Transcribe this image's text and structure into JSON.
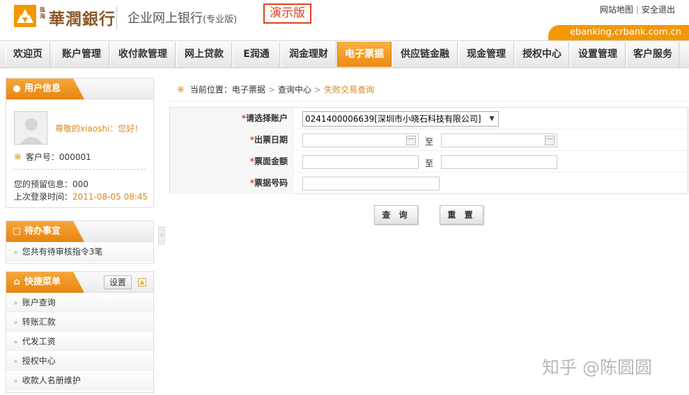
{
  "header": {
    "logo_small": "珠海",
    "bank_name": "華潤銀行",
    "system_name": "企业网上银行",
    "system_edition": "(专业版)",
    "demo_badge": "演示版",
    "links": [
      "网站地图",
      "安全退出"
    ],
    "domain": "ebanking.crbank.com.cn",
    "brand_color": "#f39800"
  },
  "nav": {
    "items": [
      {
        "label": "欢迎页"
      },
      {
        "label": "账户管理"
      },
      {
        "label": "收付款管理"
      },
      {
        "label": "网上贷款"
      },
      {
        "label": "E润通"
      },
      {
        "label": "润金理财"
      },
      {
        "label": "电子票据",
        "active": true
      },
      {
        "label": "供应链金融"
      },
      {
        "label": "现金管理"
      },
      {
        "label": "授权中心"
      },
      {
        "label": "设置管理"
      },
      {
        "label": "客户服务"
      }
    ]
  },
  "sidebar": {
    "user": {
      "title": "用户信息",
      "greeting": "尊敬的xiaoshi：您好!",
      "customer_label": "客户号：",
      "customer_no": "000001",
      "reserved_label": "您的预留信息：",
      "reserved_value": "000",
      "last_login_label": "上次登录时间：",
      "last_login_value": "2011-08-05 08:45"
    },
    "todo": {
      "title": "待办事宜",
      "items": [
        "您共有待审核指令3笔"
      ]
    },
    "shortcut": {
      "title": "快捷菜单",
      "settings_label": "设置",
      "items": [
        "账户查询",
        "转账汇款",
        "代发工资",
        "授权中心",
        "收款人名册维护"
      ]
    }
  },
  "main": {
    "breadcrumb": {
      "prefix": "当前位置：",
      "path": [
        "电子票据",
        "查询中心"
      ],
      "current": "失败交易查询"
    },
    "form": {
      "account": {
        "label": "请选择账户",
        "value": "0241400006639[深圳市小晓石科技有限公司]"
      },
      "issue_date": {
        "label": "出票日期",
        "to": "至",
        "from_value": "",
        "to_value": ""
      },
      "amount": {
        "label": "票面金额",
        "to": "至",
        "from_value": "",
        "to_value": ""
      },
      "bill_no": {
        "label": "票据号码",
        "value": ""
      }
    },
    "buttons": {
      "query": "查 询",
      "reset": "重 置"
    }
  },
  "watermark": "知乎 @陈圆圆"
}
